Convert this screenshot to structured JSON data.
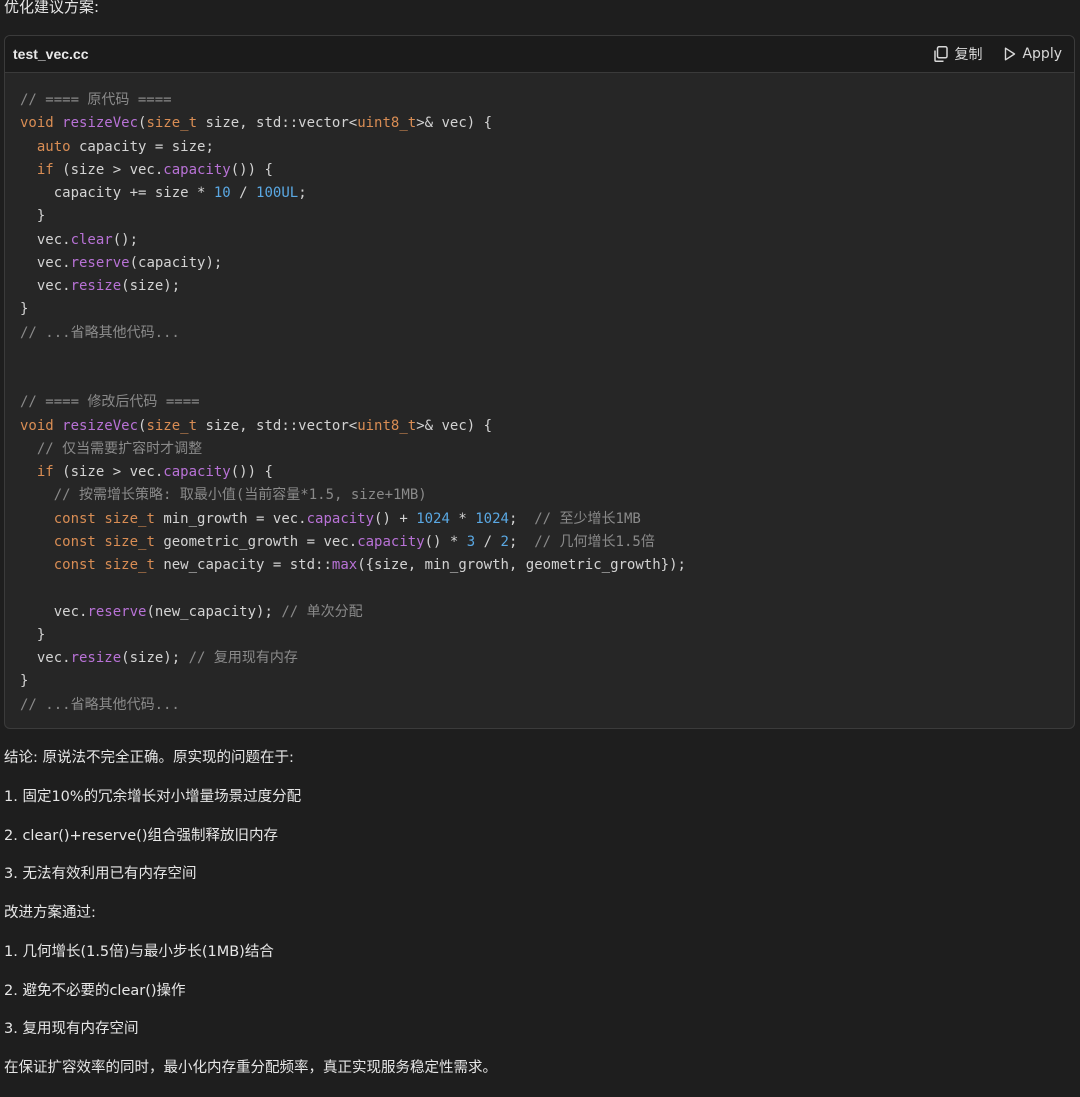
{
  "intro_text": "优化建议方案:",
  "code_block": {
    "filename": "test_vec.cc",
    "copy_label": "复制",
    "apply_label": "Apply",
    "lines": [
      [
        {
          "t": "// ==== 原代码 ====",
          "c": "c"
        }
      ],
      [
        {
          "t": "void",
          "c": "k"
        },
        {
          "t": " "
        },
        {
          "t": "resizeVec",
          "c": "m"
        },
        {
          "t": "("
        },
        {
          "t": "size_t",
          "c": "k"
        },
        {
          "t": " size, std::vector<"
        },
        {
          "t": "uint8_t",
          "c": "k"
        },
        {
          "t": ">& vec) {"
        }
      ],
      [
        {
          "t": "  "
        },
        {
          "t": "auto",
          "c": "k"
        },
        {
          "t": " capacity = size;"
        }
      ],
      [
        {
          "t": "  "
        },
        {
          "t": "if",
          "c": "k"
        },
        {
          "t": " (size > vec."
        },
        {
          "t": "capacity",
          "c": "m"
        },
        {
          "t": "()) {"
        }
      ],
      [
        {
          "t": "    capacity += size * "
        },
        {
          "t": "10",
          "c": "n"
        },
        {
          "t": " / "
        },
        {
          "t": "100UL",
          "c": "n"
        },
        {
          "t": ";"
        }
      ],
      [
        {
          "t": "  }"
        }
      ],
      [
        {
          "t": "  vec."
        },
        {
          "t": "clear",
          "c": "m"
        },
        {
          "t": "();"
        }
      ],
      [
        {
          "t": "  vec."
        },
        {
          "t": "reserve",
          "c": "m"
        },
        {
          "t": "(capacity);"
        }
      ],
      [
        {
          "t": "  vec."
        },
        {
          "t": "resize",
          "c": "m"
        },
        {
          "t": "(size);"
        }
      ],
      [
        {
          "t": "}"
        }
      ],
      [
        {
          "t": "// ...省略其他代码...",
          "c": "c"
        }
      ],
      [],
      [],
      [
        {
          "t": "// ==== 修改后代码 ====",
          "c": "c"
        }
      ],
      [
        {
          "t": "void",
          "c": "k"
        },
        {
          "t": " "
        },
        {
          "t": "resizeVec",
          "c": "m"
        },
        {
          "t": "("
        },
        {
          "t": "size_t",
          "c": "k"
        },
        {
          "t": " size, std::vector<"
        },
        {
          "t": "uint8_t",
          "c": "k"
        },
        {
          "t": ">& vec) {"
        }
      ],
      [
        {
          "t": "  "
        },
        {
          "t": "// 仅当需要扩容时才调整",
          "c": "c"
        }
      ],
      [
        {
          "t": "  "
        },
        {
          "t": "if",
          "c": "k"
        },
        {
          "t": " (size > vec."
        },
        {
          "t": "capacity",
          "c": "m"
        },
        {
          "t": "()) {"
        }
      ],
      [
        {
          "t": "    "
        },
        {
          "t": "// 按需增长策略: 取最小值(当前容量*1.5, size+1MB)",
          "c": "c"
        }
      ],
      [
        {
          "t": "    "
        },
        {
          "t": "const",
          "c": "k"
        },
        {
          "t": " "
        },
        {
          "t": "size_t",
          "c": "k"
        },
        {
          "t": " min_growth = vec."
        },
        {
          "t": "capacity",
          "c": "m"
        },
        {
          "t": "() + "
        },
        {
          "t": "1024",
          "c": "n"
        },
        {
          "t": " * "
        },
        {
          "t": "1024",
          "c": "n"
        },
        {
          "t": ";  "
        },
        {
          "t": "// 至少增长1MB",
          "c": "c"
        }
      ],
      [
        {
          "t": "    "
        },
        {
          "t": "const",
          "c": "k"
        },
        {
          "t": " "
        },
        {
          "t": "size_t",
          "c": "k"
        },
        {
          "t": " geometric_growth = vec."
        },
        {
          "t": "capacity",
          "c": "m"
        },
        {
          "t": "() * "
        },
        {
          "t": "3",
          "c": "n"
        },
        {
          "t": " / "
        },
        {
          "t": "2",
          "c": "n"
        },
        {
          "t": ";  "
        },
        {
          "t": "// 几何增长1.5倍",
          "c": "c"
        }
      ],
      [
        {
          "t": "    "
        },
        {
          "t": "const",
          "c": "k"
        },
        {
          "t": " "
        },
        {
          "t": "size_t",
          "c": "k"
        },
        {
          "t": " new_capacity = std::"
        },
        {
          "t": "max",
          "c": "m"
        },
        {
          "t": "({size, min_growth, geometric_growth});"
        }
      ],
      [],
      [
        {
          "t": "    vec."
        },
        {
          "t": "reserve",
          "c": "m"
        },
        {
          "t": "(new_capacity); "
        },
        {
          "t": "// 单次分配",
          "c": "c"
        }
      ],
      [
        {
          "t": "  }"
        }
      ],
      [
        {
          "t": "  vec."
        },
        {
          "t": "resize",
          "c": "m"
        },
        {
          "t": "(size); "
        },
        {
          "t": "// 复用现有内存",
          "c": "c"
        }
      ],
      [
        {
          "t": "}"
        }
      ],
      [
        {
          "t": "// ...省略其他代码...",
          "c": "c"
        }
      ]
    ]
  },
  "explanation": [
    "结论: 原说法不完全正确。原实现的问题在于:",
    "1. 固定10%的冗余增长对小增量场景过度分配",
    "2. clear()+reserve()组合强制释放旧内存",
    "3. 无法有效利用已有内存空间",
    "改进方案通过:",
    "1. 几何增长(1.5倍)与最小步长(1MB)结合",
    "2. 避免不必要的clear()操作",
    "3. 复用现有内存空间",
    "在保证扩容效率的同时，最小化内存重分配频率，真正实现服务稳定性需求。"
  ],
  "icons": {
    "copy": "copy-icon",
    "apply": "play-triangle-icon"
  },
  "colors": {
    "background": "#1e1e1e",
    "code_background": "#262626",
    "keyword": "#d98d54",
    "method": "#b872d6",
    "number": "#5aa8e3",
    "comment": "#8a8a8a"
  }
}
